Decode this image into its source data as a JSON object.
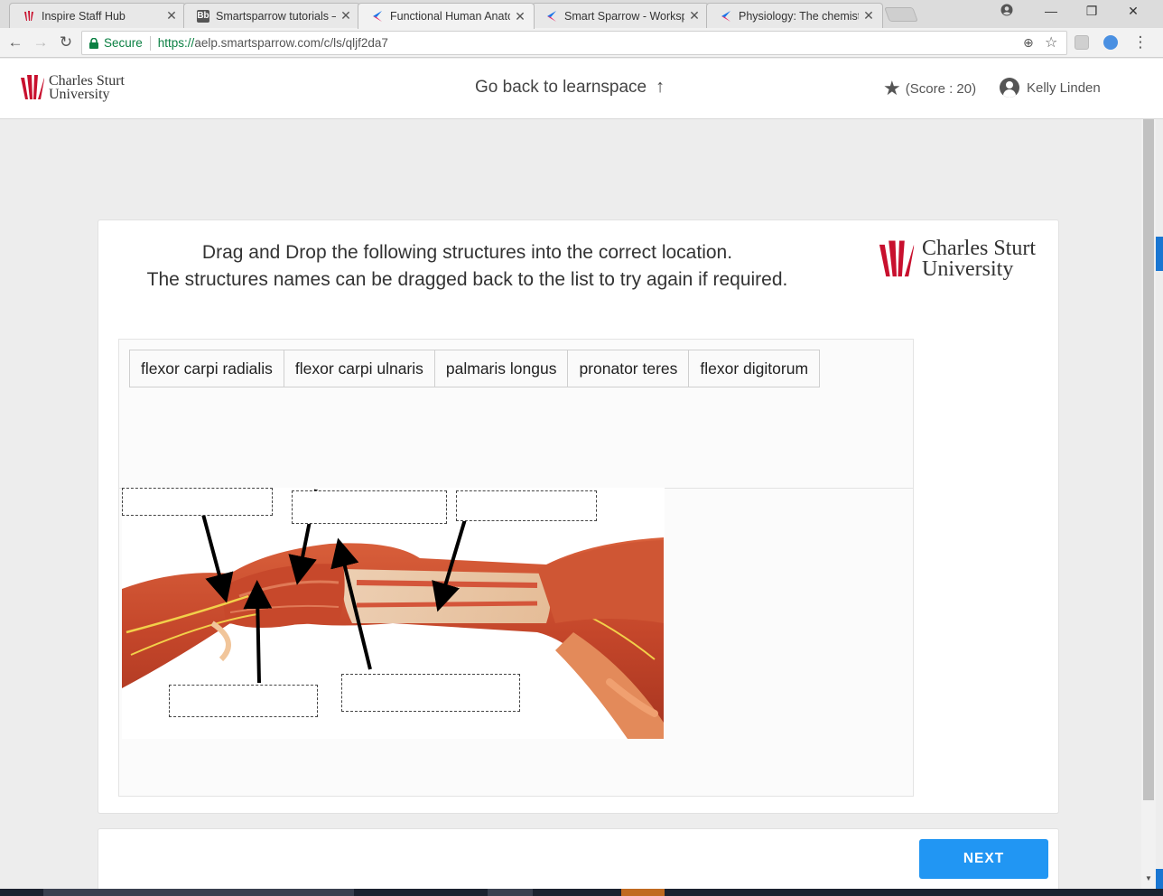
{
  "browser": {
    "tabs": [
      {
        "title": "Inspire Staff Hub",
        "icon": "tulip-logo-icon",
        "active": false
      },
      {
        "title": "Smartsparrow tutorials –",
        "icon": "blackboard-icon",
        "icon_text": "Bb",
        "active": false
      },
      {
        "title": "Functional Human Anato",
        "icon": "smart-sparrow-icon",
        "active": true
      },
      {
        "title": "Smart Sparrow - Worksp",
        "icon": "smart-sparrow-icon",
        "active": false
      },
      {
        "title": "Physiology: The chemistr",
        "icon": "smart-sparrow-icon",
        "active": false
      }
    ],
    "close_glyph": "✕",
    "window_controls": {
      "minimize": "—",
      "restore": "❐",
      "close": "✕"
    },
    "nav": {
      "back": "←",
      "forward": "→",
      "reload": "↻"
    },
    "address": {
      "secure_label": "Secure",
      "url_scheme": "https://",
      "url_rest": "aelp.smartsparrow.com/c/ls/qljf2da7"
    },
    "omni_icons": {
      "zoom": "⊕",
      "star": "☆",
      "menu": "⋮"
    }
  },
  "header": {
    "logo_line1": "Charles Sturt",
    "logo_line2": "University",
    "back_link": "Go back to learnspace",
    "back_arrow": "↑",
    "score_star": "★",
    "score": "(Score : 20)",
    "user_name": "Kelly Linden"
  },
  "lesson": {
    "instruction_line1": "Drag and Drop the following structures into the correct location.",
    "instruction_line2": "The structures names can be dragged back to the list to try again if required.",
    "logo_line1": "Charles Sturt",
    "logo_line2": "University",
    "word_bank": [
      "flexor carpi radialis",
      "flexor carpi ulnaris",
      "palmaris longus",
      "pronator teres",
      "flexor digitorum"
    ],
    "next_label": "NEXT"
  },
  "colors": {
    "brand_red": "#c8102e",
    "primary_button": "#2196f3",
    "secure_green": "#0b8043",
    "smart_sparrow_blue": "#1a73e8",
    "smart_sparrow_pink": "#e91e63"
  }
}
